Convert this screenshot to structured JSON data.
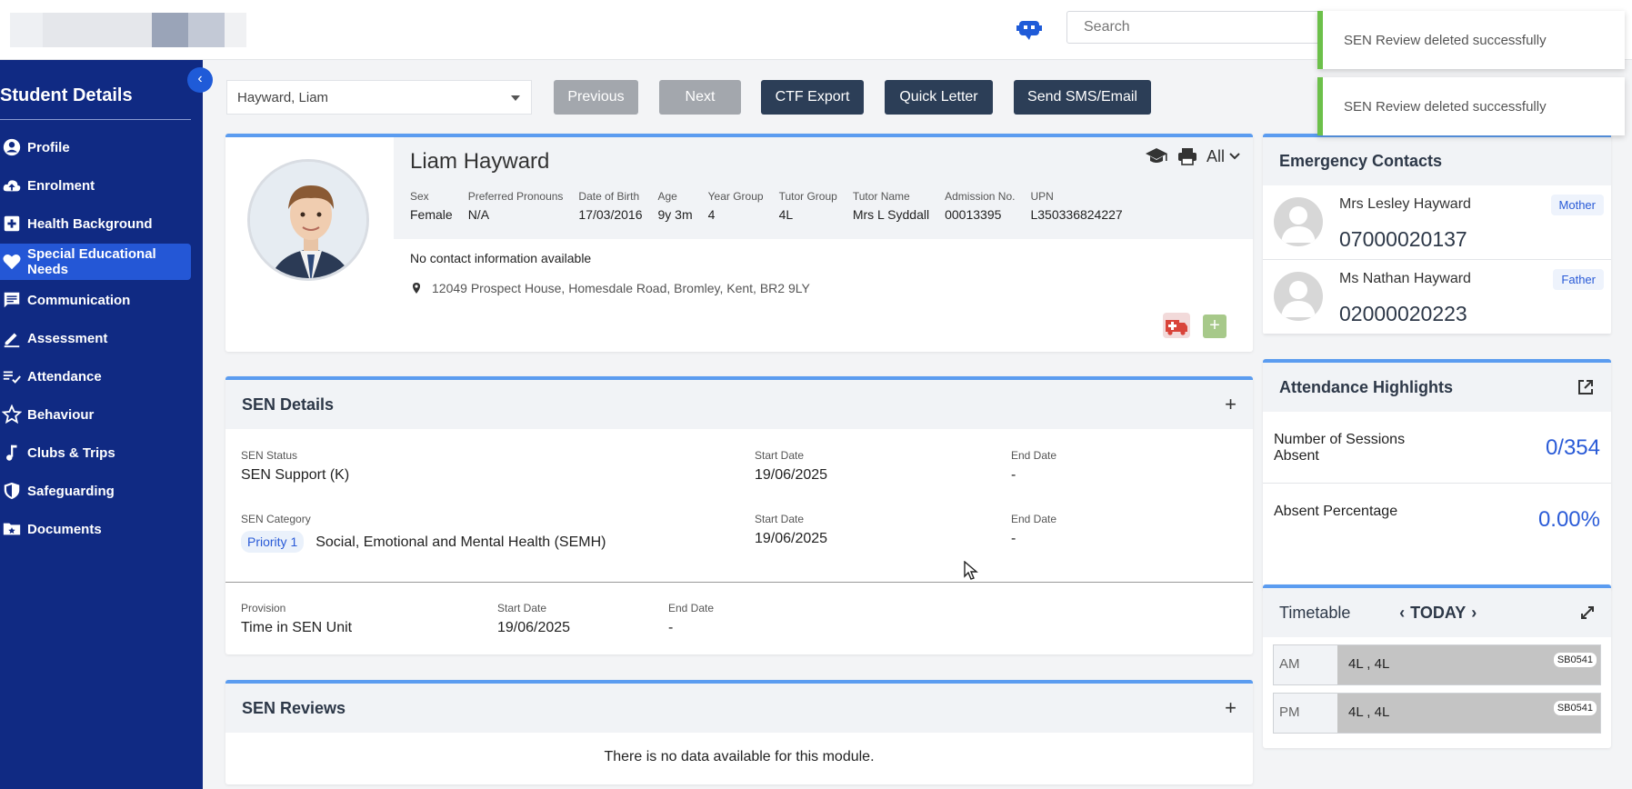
{
  "header": {
    "search_placeholder": "Search"
  },
  "toasts": [
    {
      "message": "SEN Review deleted successfully"
    },
    {
      "message": "SEN Review deleted successfully"
    }
  ],
  "sidebar": {
    "title": "Student Details",
    "items": [
      {
        "label": "Profile",
        "icon": "user-circle-icon"
      },
      {
        "label": "Enrolment",
        "icon": "cloud-upload-icon"
      },
      {
        "label": "Health Background",
        "icon": "medical-plus-icon"
      },
      {
        "label": "Special Educational Needs",
        "icon": "heart-icon",
        "active": true
      },
      {
        "label": "Communication",
        "icon": "message-icon"
      },
      {
        "label": "Assessment",
        "icon": "pencil-icon"
      },
      {
        "label": "Attendance",
        "icon": "checklist-icon"
      },
      {
        "label": "Behaviour",
        "icon": "star-icon"
      },
      {
        "label": "Clubs & Trips",
        "icon": "music-note-icon"
      },
      {
        "label": "Safeguarding",
        "icon": "shield-icon"
      },
      {
        "label": "Documents",
        "icon": "folder-icon"
      }
    ]
  },
  "toolbar": {
    "student_selected": "Hayward, Liam",
    "previous_label": "Previous",
    "next_label": "Next",
    "ctf_label": "CTF Export",
    "quick_letter_label": "Quick Letter",
    "sms_label": "Send SMS/Email"
  },
  "profile": {
    "name": "Liam Hayward",
    "filter_label": "All",
    "fields": [
      {
        "label": "Sex",
        "value": "Female"
      },
      {
        "label": "Preferred Pronouns",
        "value": "N/A"
      },
      {
        "label": "Date of Birth",
        "value": "17/03/2016"
      },
      {
        "label": "Age",
        "value": "9y 3m"
      },
      {
        "label": "Year Group",
        "value": "4"
      },
      {
        "label": "Tutor Group",
        "value": "4L"
      },
      {
        "label": "Tutor Name",
        "value": "Mrs L Syddall"
      },
      {
        "label": "Admission No.",
        "value": "00013395"
      },
      {
        "label": "UPN",
        "value": "L350336824227"
      }
    ],
    "contact_note": "No contact information available",
    "address": "12049 Prospect House, Homesdale Road, Bromley, Kent, BR2 9LY"
  },
  "sen_details": {
    "title": "SEN Details",
    "status_label": "SEN Status",
    "status_value": "SEN Support (K)",
    "status_start_label": "Start Date",
    "status_start_value": "19/06/2025",
    "status_end_label": "End Date",
    "status_end_value": "-",
    "category_label": "SEN Category",
    "category_priority": "Priority 1",
    "category_value": "Social, Emotional and Mental Health (SEMH)",
    "category_start_label": "Start Date",
    "category_start_value": "19/06/2025",
    "category_end_label": "End Date",
    "category_end_value": "-",
    "provision_label": "Provision",
    "provision_value": "Time in SEN Unit",
    "provision_start_label": "Start Date",
    "provision_start_value": "19/06/2025",
    "provision_end_label": "End Date",
    "provision_end_value": "-"
  },
  "sen_reviews": {
    "title": "SEN Reviews",
    "empty_message": "There is no data available for this module."
  },
  "emergency": {
    "title": "Emergency Contacts",
    "contacts": [
      {
        "name": "Mrs Lesley Hayward",
        "phone": "07000020137",
        "relation": "Mother"
      },
      {
        "name": "Ms Nathan Hayward",
        "phone": "02000020223",
        "relation": "Father"
      }
    ]
  },
  "attendance": {
    "title": "Attendance Highlights",
    "rows": [
      {
        "label": "Number of Sessions Absent",
        "value": "0/354"
      },
      {
        "label": "Absent Percentage",
        "value": "0.00%"
      }
    ]
  },
  "timetable": {
    "title": "Timetable",
    "today_label": "TODAY",
    "rows": [
      {
        "period": "AM",
        "slot": "4L , 4L",
        "room": "SB0541"
      },
      {
        "period": "PM",
        "slot": "4L , 4L",
        "room": "SB0541"
      }
    ]
  },
  "colors": {
    "sidebar_bg": "#102a83",
    "active_nav": "#2457d6",
    "accent_blue": "#2a5bd7",
    "card_top_border": "#5b9cf0",
    "toast_success": "#6cc04a"
  }
}
